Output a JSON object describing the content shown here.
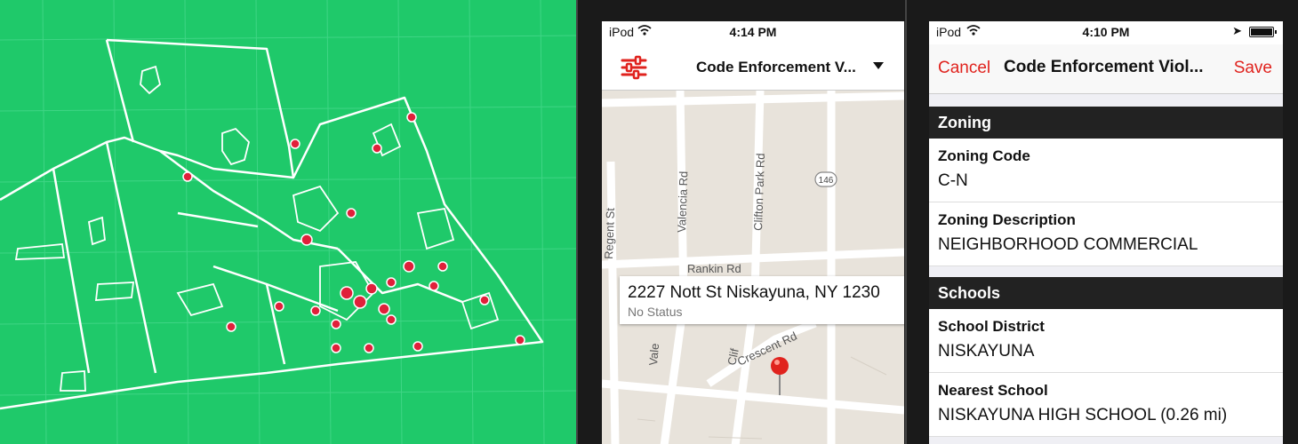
{
  "phone_left": {
    "status": {
      "carrier": "iPod",
      "time": "4:14 PM"
    },
    "nav": {
      "title": "Code Enforcement V...",
      "filter_icon": "sliders-icon",
      "dropdown_icon": "caret-down-icon"
    },
    "map": {
      "streets": [
        "Valencia Rd",
        "Clifton Park Rd",
        "Rankin Rd",
        "Regent St",
        "Vale",
        "Clif",
        "Crescent Rd"
      ],
      "route_shield": "146",
      "callout": {
        "address": "2227 Nott St Niskayuna, NY 1230",
        "status": "No Status"
      }
    }
  },
  "phone_right": {
    "status": {
      "carrier": "iPod",
      "time": "4:10 PM"
    },
    "nav": {
      "cancel": "Cancel",
      "title": "Code Enforcement Viol...",
      "save": "Save"
    },
    "sections": [
      {
        "header": "Zoning",
        "fields": [
          {
            "label": "Zoning Code",
            "value": "C-N"
          },
          {
            "label": "Zoning Description",
            "value": "NEIGHBORHOOD COMMERCIAL"
          }
        ]
      },
      {
        "header": "Schools",
        "fields": [
          {
            "label": "School District",
            "value": "NISKAYUNA"
          },
          {
            "label": "Nearest School",
            "value": "NISKAYUNA HIGH SCHOOL (0.26 mi)"
          }
        ]
      }
    ]
  },
  "colors": {
    "background_green": "#1fc96a",
    "accent_red": "#e0231e",
    "section_dark": "#222222"
  }
}
